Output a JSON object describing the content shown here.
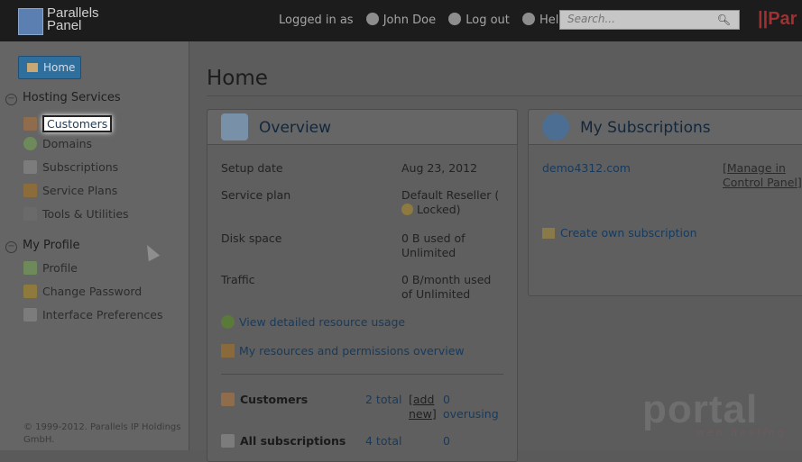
{
  "header": {
    "logo_line1": "Parallels",
    "logo_line2": "Panel",
    "logged_in_prefix": "Logged in as",
    "user_name": "John Doe",
    "logout_label": "Log out",
    "help_label": "Help",
    "search_placeholder": "Search...",
    "brand_right": "||Par"
  },
  "sidebar": {
    "home_label": "Home",
    "section1_title": "Hosting Services",
    "section1_items": [
      "Customers",
      "Domains",
      "Subscriptions",
      "Service Plans",
      "Tools & Utilities"
    ],
    "section2_title": "My Profile",
    "section2_items": [
      "Profile",
      "Change Password",
      "Interface Preferences"
    ],
    "copyright": "© 1999-2012. Parallels IP Holdings GmbH."
  },
  "main": {
    "page_title": "Home",
    "overview": {
      "title": "Overview",
      "rows": [
        {
          "label": "Setup date",
          "value": "Aug 23, 2012"
        },
        {
          "label": "Service plan",
          "value": "Default Reseller (",
          "value_extra": "Locked)"
        },
        {
          "label": "Disk space",
          "value": "0 B used of Unlimited"
        },
        {
          "label": "Traffic",
          "value": "0 B/month used of Unlimited"
        }
      ],
      "link1": "View detailed resource usage",
      "link2": "My resources and permissions overview",
      "stats": [
        {
          "label": "Customers",
          "total": "2 total",
          "add": "[add new]",
          "over": "0 overusing"
        },
        {
          "label": "All subscriptions",
          "total": "4 total",
          "over": "0"
        }
      ]
    },
    "subscriptions": {
      "title": "My Subscriptions",
      "domain": "demo4312.com",
      "manage": "[Manage in Control Panel]",
      "create": "Create own subscription"
    }
  },
  "watermark": {
    "text": "portal",
    "sub": "web hosting"
  }
}
